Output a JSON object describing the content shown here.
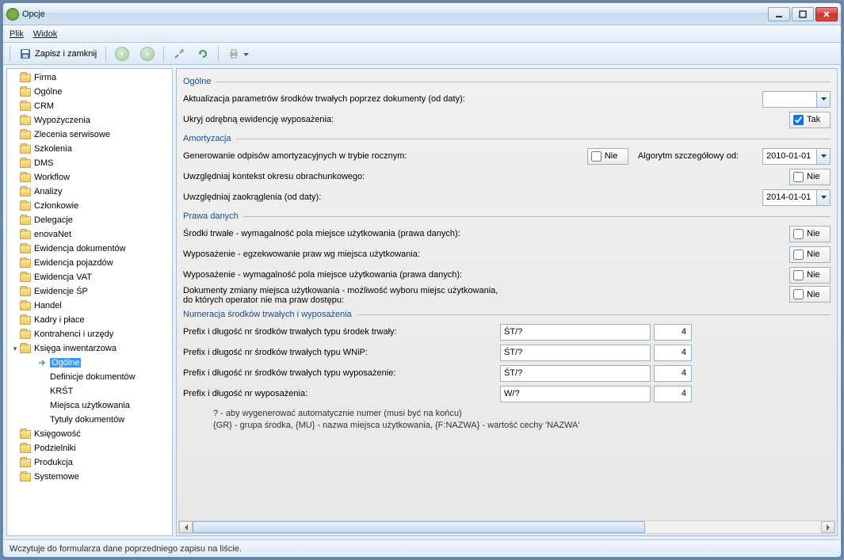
{
  "window": {
    "title": "Opcje"
  },
  "menu": {
    "file": "Plik",
    "view": "Widok"
  },
  "toolbar": {
    "save_close": "Zapisz i zamknij"
  },
  "tree": {
    "items_above": [
      "Firma",
      "Ogólne",
      "CRM",
      "Wypożyczenia",
      "Zlecenia serwisowe",
      "Szkolenia",
      "DMS",
      "Workflow",
      "Analizy",
      "Członkowie",
      "Delegacje",
      "enovaNet",
      "Ewidencja dokumentów",
      "Ewidencja pojazdów",
      "Ewidencja VAT",
      "Ewidencje ŚP",
      "Handel",
      "Kadry i płace",
      "Kontrahenci i urzędy"
    ],
    "expanded": "Księga inwentarzowa",
    "children": [
      "Ogólne",
      "Definicje dokumentów",
      "KRŚT",
      "Miejsca użytkowania",
      "Tytuły dokumentów"
    ],
    "selected_child": "Ogólne",
    "items_below": [
      "Księgowość",
      "Podzielniki",
      "Produkcja",
      "Systemowe"
    ]
  },
  "form": {
    "sec1": {
      "title": "Ogólne",
      "row1_label": "Aktualizacja parametrów środków trwałych poprzez dokumenty (od daty):",
      "row1_value": "",
      "row2_label": "Ukryj odrębną ewidencję wyposażenia:",
      "row2_value": "Tak"
    },
    "sec2": {
      "title": "Amortyzacja",
      "row1_label": "Generowanie odpisów amortyzacyjnych w trybie rocznym:",
      "row1_value": "Nie",
      "row1_label2": "Algorytm szczegółowy od:",
      "row1_date": "2010-01-01",
      "row2_label": "Uwzględniaj kontekst okresu obrachunkowego:",
      "row2_value": "Nie",
      "row3_label": "Uwzględniaj zaokrąglenia (od daty):",
      "row3_date": "2014-01-01"
    },
    "sec3": {
      "title": "Prawa danych",
      "row1_label": "Środki trwałe - wymagalność pola miejsce użytkowania (prawa danych):",
      "row1_value": "Nie",
      "row2_label": "Wyposażenie - egzekwowanie praw wg miejsca użytkowania:",
      "row2_value": "Nie",
      "row3_label": "Wyposażenie - wymagalność pola miejsce użytkowania (prawa danych):",
      "row3_value": "Nie",
      "row4_label1": "Dokumenty zmiany miejsca użytkowania - możliwość wyboru miejsc użytkowania,",
      "row4_label2": "do których operator nie ma praw dostępu:",
      "row4_value": "Nie"
    },
    "sec4": {
      "title": "Numeracja środków trwałych i wyposażenia",
      "row1_label": "Prefix i długość nr środków trwałych typu środek trwały:",
      "row1_prefix": "ŚT/?",
      "row1_len": "4",
      "row2_label": "Prefix i długość nr środków trwałych typu WNiP:",
      "row2_prefix": "ŚT/?",
      "row2_len": "4",
      "row3_label": "Prefix i długość nr środków trwałych typu wyposażenie:",
      "row3_prefix": "ŚT/?",
      "row3_len": "4",
      "row4_label": "Prefix i długość nr wyposażenia:",
      "row4_prefix": "W/?",
      "row4_len": "4",
      "help1": "? - aby wygenerować automatycznie numer (musi być na końcu)",
      "help2": "{GR} - grupa środka, {MU} - nazwa miejsca użytkowania, {F:NAZWA} - wartość cechy 'NAZWA'"
    }
  },
  "status": "Wczytuje do formularza dane poprzedniego zapisu na liście."
}
